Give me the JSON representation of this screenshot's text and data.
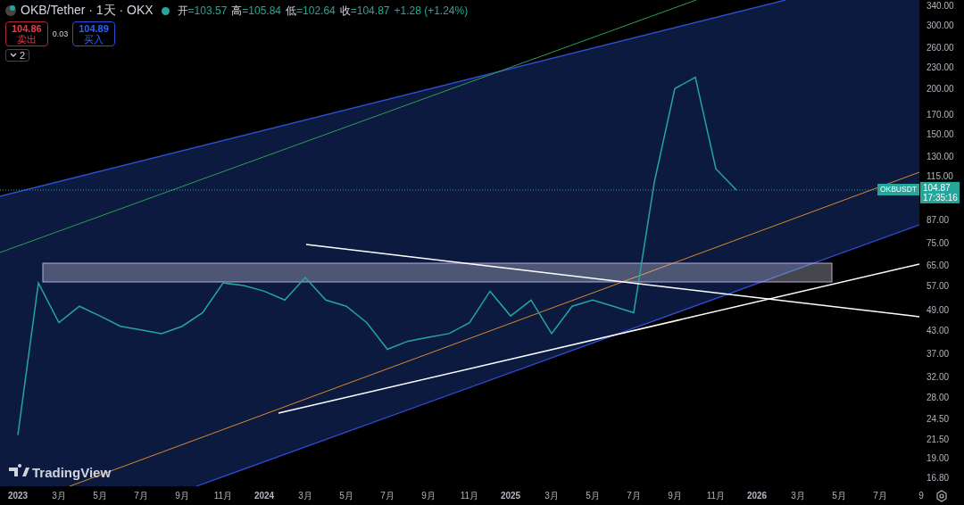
{
  "header": {
    "symbol": "OKB/Tether · 1天 · OKX",
    "ohlc": [
      {
        "label": "开",
        "value": "=103.57"
      },
      {
        "label": "高",
        "value": "=105.84"
      },
      {
        "label": "低",
        "value": "=102.64"
      },
      {
        "label": "收",
        "value": "=104.87"
      }
    ],
    "change": "+1.28 (+1.24%)"
  },
  "trade": {
    "sell_price": "104.86",
    "sell_label": "卖出",
    "spread": "0.03",
    "buy_price": "104.89",
    "buy_label": "买入"
  },
  "indicators_toggle": "2",
  "price_tag": {
    "symbol": "OKBUSDT",
    "price": "104.87",
    "countdown": "17:35:16"
  },
  "logo": "TradingView",
  "price_axis": [
    "340.00",
    "300.00",
    "260.00",
    "230.00",
    "200.00",
    "170.00",
    "150.00",
    "130.00",
    "115.00",
    "87.00",
    "75.00",
    "65.00",
    "57.00",
    "49.00",
    "43.00",
    "37.00",
    "32.00",
    "28.00",
    "24.50",
    "21.50",
    "19.00",
    "16.80"
  ],
  "time_axis": [
    {
      "label": "2023",
      "kind": "year"
    },
    {
      "label": "3月",
      "kind": "month"
    },
    {
      "label": "5月",
      "kind": "month"
    },
    {
      "label": "7月",
      "kind": "month"
    },
    {
      "label": "9月",
      "kind": "month"
    },
    {
      "label": "11月",
      "kind": "month"
    },
    {
      "label": "2024",
      "kind": "year"
    },
    {
      "label": "3月",
      "kind": "month"
    },
    {
      "label": "5月",
      "kind": "month"
    },
    {
      "label": "7月",
      "kind": "month"
    },
    {
      "label": "9月",
      "kind": "month"
    },
    {
      "label": "11月",
      "kind": "month"
    },
    {
      "label": "2025",
      "kind": "year"
    },
    {
      "label": "3月",
      "kind": "month"
    },
    {
      "label": "5月",
      "kind": "month"
    },
    {
      "label": "7月",
      "kind": "month"
    },
    {
      "label": "9月",
      "kind": "month"
    },
    {
      "label": "11月",
      "kind": "month"
    },
    {
      "label": "2026",
      "kind": "year"
    },
    {
      "label": "3月",
      "kind": "month"
    },
    {
      "label": "5月",
      "kind": "month"
    },
    {
      "label": "7月",
      "kind": "month"
    },
    {
      "label": "9",
      "kind": "month"
    }
  ]
}
